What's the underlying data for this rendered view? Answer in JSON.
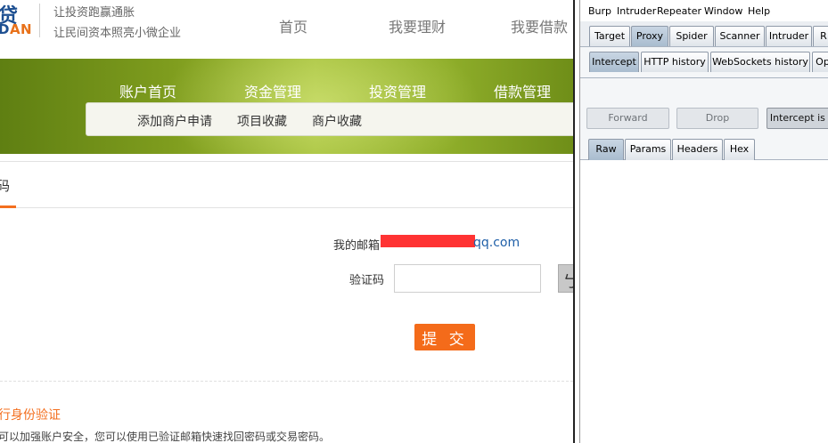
{
  "site": {
    "logo_char": "贷",
    "logo_en_dark": "D",
    "logo_en_accent": "AN",
    "slogan_line1": "让投资跑赢通胀",
    "slogan_line2": "让民间资本照亮小微企业",
    "top_nav": [
      "首页",
      "我要理财",
      "我要借款"
    ],
    "main_nav": [
      "账户首页",
      "资金管理",
      "投资管理",
      "借款管理"
    ],
    "sub_nav": [
      "添加商户申请",
      "项目收藏",
      "商户收藏"
    ],
    "tab_fragment": "码",
    "email_label": "我的邮箱",
    "email_visible_tail": "qq.com",
    "code_label": "验证码",
    "code_value": "",
    "captcha_char": "ㄅ",
    "submit_label": "提 交",
    "verify_title": "行身份验证",
    "verify_desc": "可以加强账户安全，您可以使用已验证邮箱快速找回密码或交易密码。",
    "accent_color": "#f46b1a",
    "banner_color": "#8fae2a"
  },
  "burp": {
    "menu": [
      "Burp",
      "Intruder",
      "Repeater",
      "Window",
      "Help"
    ],
    "main_tabs": [
      "Target",
      "Proxy",
      "Spider",
      "Scanner",
      "Intruder",
      "R"
    ],
    "main_tab_active": "Proxy",
    "proxy_tabs": [
      "Intercept",
      "HTTP history",
      "WebSockets history",
      "Op"
    ],
    "proxy_tab_active": "Intercept",
    "buttons": {
      "forward": "Forward",
      "drop": "Drop",
      "intercept": "Intercept is o"
    },
    "message_tabs": [
      "Raw",
      "Params",
      "Headers",
      "Hex"
    ],
    "message_tab_active": "Raw"
  }
}
